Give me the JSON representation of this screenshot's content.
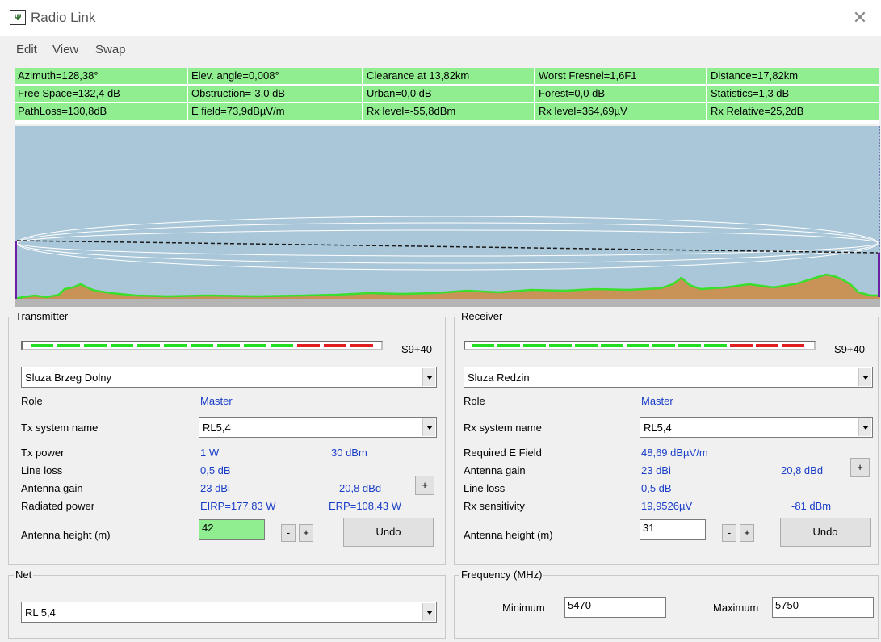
{
  "window": {
    "title": "Radio Link",
    "icon": "radio-link-app-icon",
    "icon_glyph": "Ψ",
    "close_glyph": "✕"
  },
  "menu": [
    "Edit",
    "View",
    "Swap"
  ],
  "info": {
    "rows": [
      [
        "Azimuth=128,38°",
        "Elev. angle=0,008°",
        "Clearance at 13,82km",
        "Worst Fresnel=1,6F1",
        "Distance=17,82km"
      ],
      [
        "Free Space=132,4 dB",
        "Obstruction=-3,0 dB",
        "Urban=0,0 dB",
        "Forest=0,0 dB",
        "Statistics=1,3 dB"
      ],
      [
        "PathLoss=130,8dB",
        "E field=73,9dBµV/m",
        "Rx level=-55,8dBm",
        "Rx level=364,69µV",
        "Rx Relative=25,2dB"
      ]
    ],
    "cell_color": "#90ee90"
  },
  "profile": {
    "sky_color": "#a9c7d8",
    "terrain_color": "#c99257",
    "terrain_line_color": "#3adf2c",
    "antenna_color": "#6a1fa5"
  },
  "transmitter": {
    "title": "Transmitter",
    "signal_label": "S9+40",
    "signal": {
      "green_segments": 10,
      "red_segments": 3
    },
    "site": "Sluza Brzeg Dolny",
    "role_label": "Role",
    "role": "Master",
    "system_label": "Tx system name",
    "system": "RL5,4",
    "power_label": "Tx power",
    "power_w": "1 W",
    "power_dbm": "30 dBm",
    "line_loss_label": "Line loss",
    "line_loss": "0,5 dB",
    "gain_label": "Antenna gain",
    "gain_dbi": "23 dBi",
    "gain_dbd": "20,8 dBd",
    "radiated_label": "Radiated power",
    "eirp": "EIRP=177,83 W",
    "erp": "ERP=108,43 W",
    "height_label": "Antenna height (m)",
    "height": "42",
    "minus": "-",
    "plus": "+",
    "undo": "Undo"
  },
  "receiver": {
    "title": "Receiver",
    "signal_label": "S9+40",
    "signal": {
      "green_segments": 10,
      "red_segments": 3
    },
    "site": "Sluza Redzin",
    "role_label": "Role",
    "role": "Master",
    "system_label": "Rx system name",
    "system": "RL5,4",
    "req_field_label": "Required E Field",
    "req_field": "48,69 dBµV/m",
    "gain_label": "Antenna gain",
    "gain_dbi": "23 dBi",
    "gain_dbd": "20,8 dBd",
    "line_loss_label": "Line loss",
    "line_loss": "0,5 dB",
    "sens_label": "Rx sensitivity",
    "sens_uv": "19,9526µV",
    "sens_dbm": "-81 dBm",
    "height_label": "Antenna height (m)",
    "height": "31",
    "minus": "-",
    "plus": "+",
    "undo": "Undo"
  },
  "net": {
    "title": "Net",
    "value": "RL 5,4"
  },
  "frequency": {
    "title": "Frequency (MHz)",
    "min_label": "Minimum",
    "min": "5470",
    "max_label": "Maximum",
    "max": "5750"
  }
}
